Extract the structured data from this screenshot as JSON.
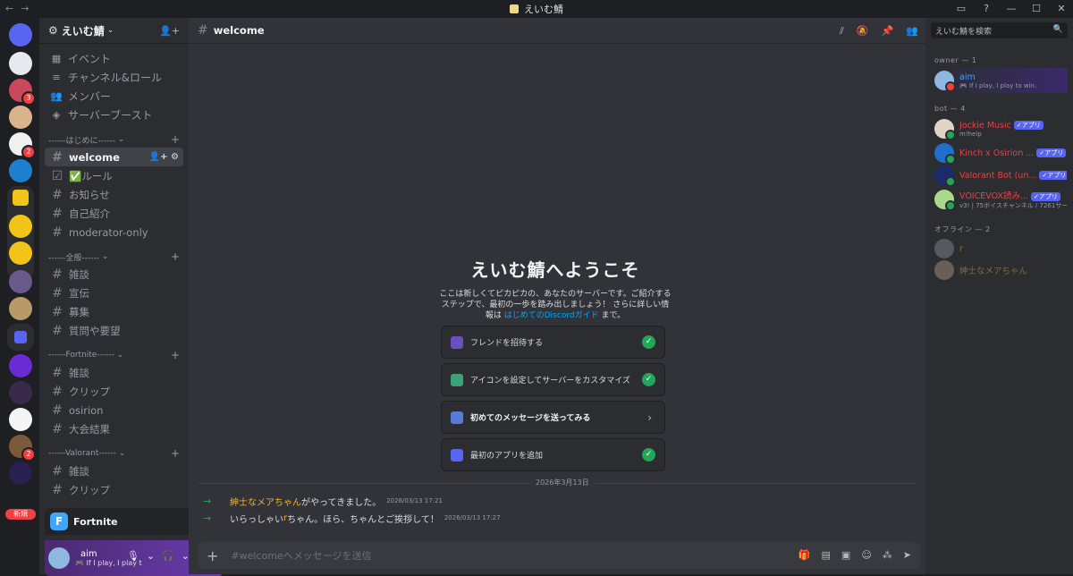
{
  "window": {
    "title": "えいむ鯖"
  },
  "server": {
    "name": "えいむ鯖"
  },
  "nav": [
    {
      "label": "イベント",
      "icon": "calendar-icon"
    },
    {
      "label": "チャンネル&ロール",
      "icon": "channels-roles-icon"
    },
    {
      "label": "メンバー",
      "icon": "members-icon"
    },
    {
      "label": "サーバーブースト",
      "icon": "boost-icon"
    }
  ],
  "categories": [
    {
      "name": "------はじめに------",
      "channels": [
        "welcome",
        "✅ルール",
        "お知らせ",
        "自己紹介",
        "moderator-only"
      ]
    },
    {
      "name": "------全般------",
      "channels": [
        "雑談",
        "宣伝",
        "募集",
        "質問や要望"
      ]
    },
    {
      "name": "------Fortnite------",
      "channels": [
        "雑談",
        "クリップ",
        "osirion",
        "大会結果"
      ]
    },
    {
      "name": "------Valorant------",
      "channels": [
        "雑談",
        "クリップ"
      ]
    }
  ],
  "active_channel": "welcome",
  "guild_badges": {
    "b1": "3",
    "b2": "2",
    "b3": "2",
    "new": "新規"
  },
  "voice": {
    "title": "Fortnite"
  },
  "user": {
    "name": "aim",
    "status": "🎮 If I play, I play t"
  },
  "welcome": {
    "title": "えいむ鯖へようこそ",
    "desc_pre": "ここは新しくてピカピカの、あなたのサーバーです。ご紹介するステップで、最初の一歩を踏み出しましょう！ さらに詳しい情報は ",
    "desc_link": "はじめてのDiscordガイド",
    "desc_post": " まで。",
    "steps": [
      {
        "label": "フレンドを招待する",
        "done": true,
        "color": "#6b4fbf"
      },
      {
        "label": "アイコンを設定してサーバーをカスタマイズ",
        "done": true,
        "color": "#3aa17a"
      },
      {
        "label": "初めてのメッセージを送ってみる",
        "done": false,
        "color": "#5a7ad9"
      },
      {
        "label": "最初のアプリを追加",
        "done": true,
        "color": "#5865f2"
      }
    ]
  },
  "date_divider": "2026年3月13日",
  "messages": [
    {
      "who": "紳士なメアちゃん",
      "text": "がやってきました。",
      "ts": "2026/03/13 17:21"
    },
    {
      "pre": "いらっしゃい",
      "who": "r",
      "text": "ちゃん。ほら、ちゃんとご挨拶して！",
      "ts": "2026/03/13 17:27"
    }
  ],
  "composer": {
    "placeholder": "#welcomeへメッセージを送信"
  },
  "member_search": {
    "placeholder": "えいむ鯖を検索"
  },
  "members": {
    "owner_label": "owner — 1",
    "bot_label": "bot — 4",
    "offline_label": "オフライン — 2",
    "owner": [
      {
        "name": "aim",
        "status": "🎮 If I play, I play to win.",
        "color": "#3ea6ff"
      }
    ],
    "bots": [
      {
        "name": "Jockie Music",
        "status": "m!help",
        "color": "#f23f43",
        "badge": "✓アプリ"
      },
      {
        "name": "Kinch x Osirion ...",
        "status": "",
        "color": "#f23f43",
        "badge": "✓アプリ"
      },
      {
        "name": "Valorant Bot (un...",
        "status": "",
        "color": "#f23f43",
        "badge": "✓アプリ"
      },
      {
        "name": "VOICEVOX読み...",
        "status": "v3! | 75ボイスチャンネル / 7261サー",
        "color": "#f23f43",
        "badge": "✓アプリ"
      }
    ],
    "offline": [
      {
        "name": "r",
        "color": "#f0b232"
      },
      {
        "name": "紳士なメアちゃん",
        "color": "#f0b232"
      }
    ]
  }
}
